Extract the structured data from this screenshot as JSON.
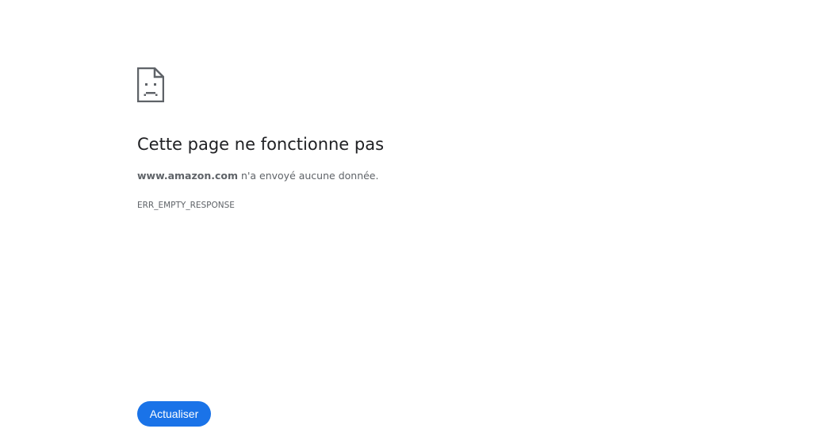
{
  "error": {
    "icon": "sad-page-icon",
    "headline": "Cette page ne fonctionne pas",
    "host": "www.amazon.com",
    "summary_suffix": "n'a envoyé aucune donnée.",
    "code": "ERR_EMPTY_RESPONSE"
  },
  "actions": {
    "reload_label": "Actualiser"
  },
  "colors": {
    "button_bg": "#1a73e8",
    "text_primary": "#202124",
    "text_secondary": "#5f6368"
  }
}
